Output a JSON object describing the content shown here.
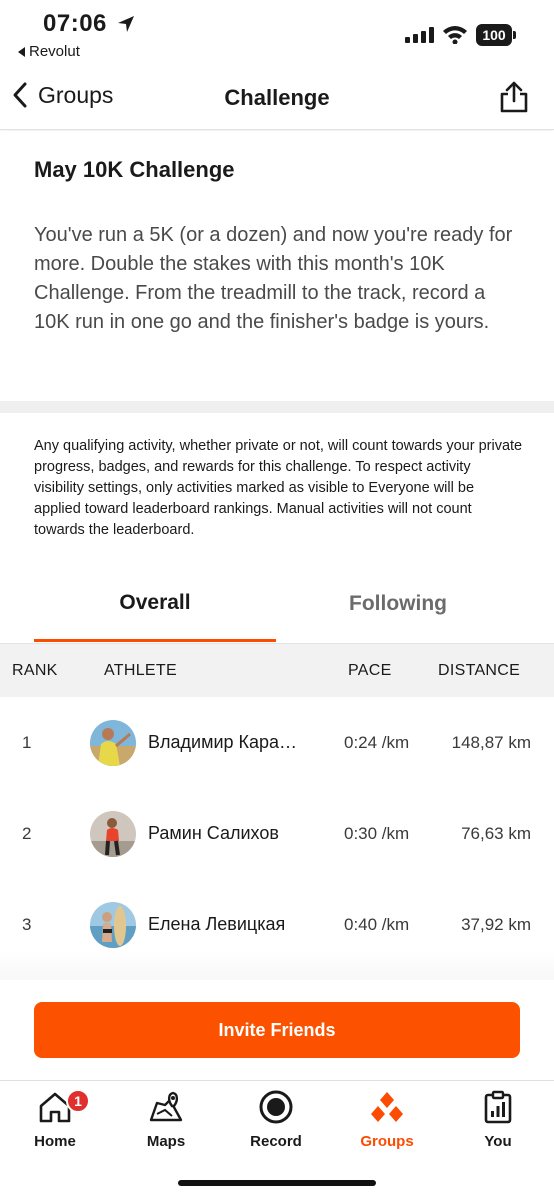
{
  "status_bar": {
    "time": "07:06",
    "back_app": "Revolut",
    "battery": "100"
  },
  "nav": {
    "back_label": "Groups",
    "title": "Challenge"
  },
  "challenge": {
    "title": "May 10K Challenge",
    "description": "You've run a 5K (or a dozen) and now you're ready for more. Double the stakes with this month's 10K Challenge. From the treadmill to the track, record a 10K run in one go and the finisher's badge is yours."
  },
  "disclaimer": "Any qualifying activity, whether private or not, will count towards your private progress, badges, and rewards for this challenge. To respect activity visibility settings, only activities marked as visible to Everyone will be applied toward leaderboard rankings. Manual activities will not count towards the leaderboard.",
  "tabs": {
    "overall": "Overall",
    "following": "Following",
    "selected": "Overall"
  },
  "leaderboard": {
    "headers": {
      "rank": "RANK",
      "athlete": "ATHLETE",
      "pace": "PACE",
      "distance": "DISTANCE"
    },
    "rows": [
      {
        "rank": "1",
        "athlete": "Владимир Кара…",
        "pace": "0:24 /km",
        "distance": "148,87 km"
      },
      {
        "rank": "2",
        "athlete": "Рамин Салихов",
        "pace": "0:30 /km",
        "distance": "76,63 km"
      },
      {
        "rank": "3",
        "athlete": "Елена Левицкая",
        "pace": "0:40 /km",
        "distance": "37,92 km"
      }
    ]
  },
  "invite_button": "Invite Friends",
  "tab_bar": {
    "items": [
      {
        "label": "Home",
        "icon": "home-icon",
        "badge": "1"
      },
      {
        "label": "Maps",
        "icon": "maps-icon"
      },
      {
        "label": "Record",
        "icon": "record-icon"
      },
      {
        "label": "Groups",
        "icon": "groups-icon",
        "active": true
      },
      {
        "label": "You",
        "icon": "you-icon"
      }
    ]
  },
  "colors": {
    "accent": "#fc4c02",
    "badge": "#e0302e"
  }
}
